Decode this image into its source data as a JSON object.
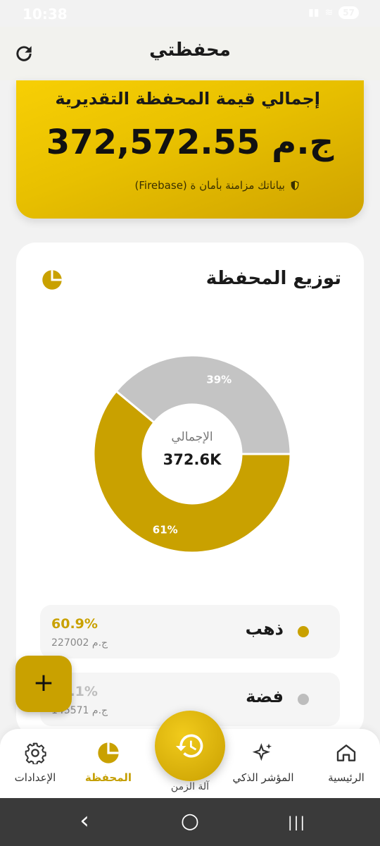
{
  "status": {
    "time": "10:38",
    "battery": "57"
  },
  "app": {
    "title": "محفظتي"
  },
  "hero": {
    "label": "إجمالي قيمة المحفظة التقديرية",
    "value": "372,572.55 ج.م",
    "sync_note": "بياناتك مزامنة بأمان ة (Firebase)"
  },
  "portfolio": {
    "title": "توزيع المحفظة",
    "center_label": "الإجمالي",
    "center_value": "372.6K"
  },
  "chart_data": {
    "type": "pie",
    "categories": [
      "ذهب",
      "فضة"
    ],
    "values": [
      61,
      39
    ],
    "labels": [
      "61%",
      "39%"
    ],
    "colors": [
      "#c9a100",
      "#c4c4c4"
    ]
  },
  "legend": [
    {
      "name": "ذهب",
      "percent": "60.9%",
      "amount": "227002 ج.م",
      "color": "#c9a100"
    },
    {
      "name": "فضة",
      "percent": "39.1%",
      "amount": "145571 ج.م",
      "color": "#bdbdbd"
    }
  ],
  "fab": {
    "label": "+"
  },
  "nav": {
    "home": "الرئيسية",
    "smart": "المؤشر الذكي",
    "time_machine": "آلة الزمن",
    "portfolio": "المحفظة",
    "settings": "الإعدادات"
  },
  "sys_nav": {
    "back": "‹",
    "home": "○",
    "recents": "|||"
  }
}
